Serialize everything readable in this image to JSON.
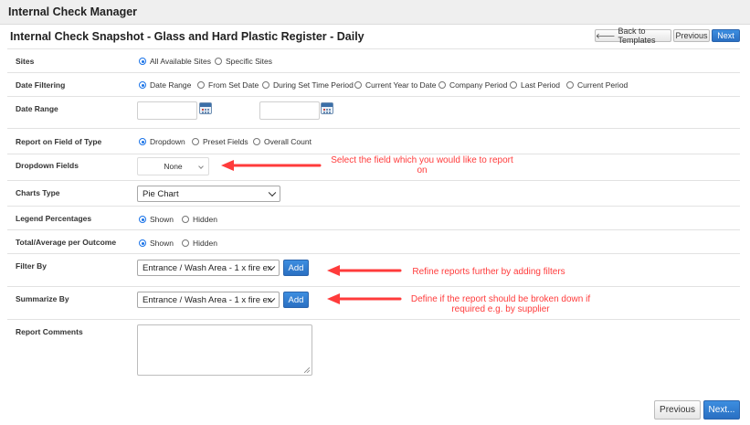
{
  "app": {
    "title": "Internal Check Manager"
  },
  "page": {
    "title": "Internal Check Snapshot - Glass and Hard Plastic Register - Daily"
  },
  "toolbar": {
    "back_label": "Back to Templates",
    "previous_label": "Previous",
    "next_label": "Next"
  },
  "form": {
    "sites": {
      "label": "Sites",
      "options": [
        "All Available Sites",
        "Specific Sites"
      ],
      "selected": 0
    },
    "date_filtering": {
      "label": "Date Filtering",
      "options": [
        "Date Range",
        "From Set Date",
        "During Set Time Period",
        "Current Year to Date",
        "Company Period",
        "Last Period",
        "Current Period"
      ],
      "selected": 0
    },
    "date_range": {
      "label": "Date Range",
      "start_value": "",
      "end_value": ""
    },
    "report_on": {
      "label": "Report on Field of Type",
      "options": [
        "Dropdown",
        "Preset Fields",
        "Overall Count"
      ],
      "selected": 0
    },
    "dropdown_fields": {
      "label": "Dropdown Fields",
      "value": "None"
    },
    "charts_type": {
      "label": "Charts Type",
      "value": "Pie Chart"
    },
    "legend_percentages": {
      "label": "Legend Percentages",
      "options": [
        "Shown",
        "Hidden"
      ],
      "selected": 0
    },
    "total_average": {
      "label": "Total/Average per Outcome",
      "options": [
        "Shown",
        "Hidden"
      ],
      "selected": 0
    },
    "filter_by": {
      "label": "Filter By",
      "value": "Entrance / Wash Area - 1 x fire ex",
      "add_label": "Add"
    },
    "summarize_by": {
      "label": "Summarize By",
      "value": "Entrance / Wash Area - 1 x fire ex",
      "add_label": "Add"
    },
    "report_comments": {
      "label": "Report Comments",
      "value": ""
    }
  },
  "annotations": {
    "dropdown_note": "Select the field which you would like to report on",
    "filter_note": "Refine reports further by adding filters",
    "summarize_note": "Define if the report should be broken down if required e.g. by supplier",
    "color": "#ff3b3b"
  },
  "footer": {
    "previous_label": "Previous",
    "next_label": "Next..."
  },
  "colors": {
    "accent": "#2a6fc2",
    "header_bg": "#efefef"
  }
}
